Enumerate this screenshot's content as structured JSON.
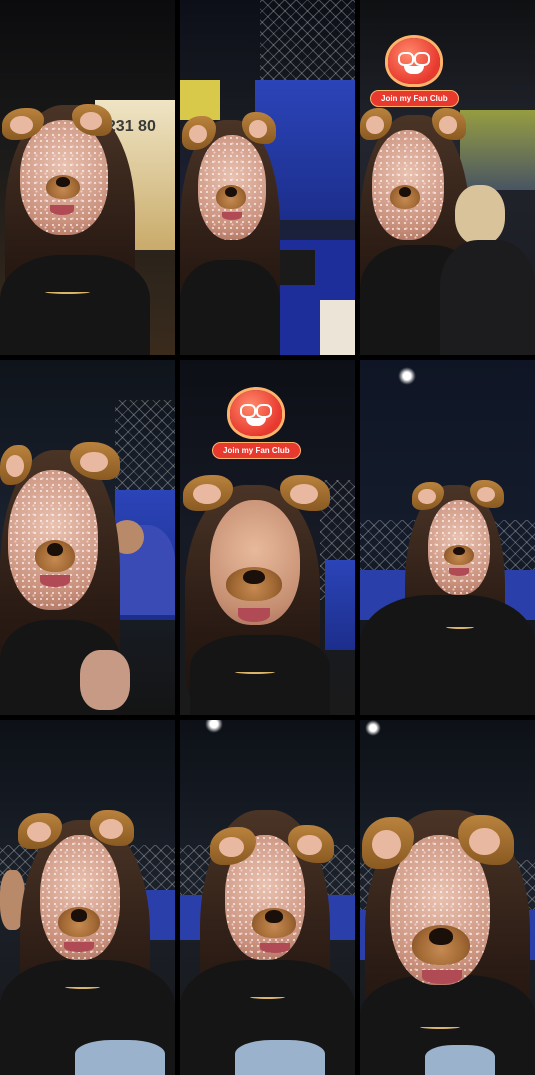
{
  "fan_club": {
    "label": "Join my Fan Club"
  },
  "sign": {
    "text": "0231 80"
  }
}
